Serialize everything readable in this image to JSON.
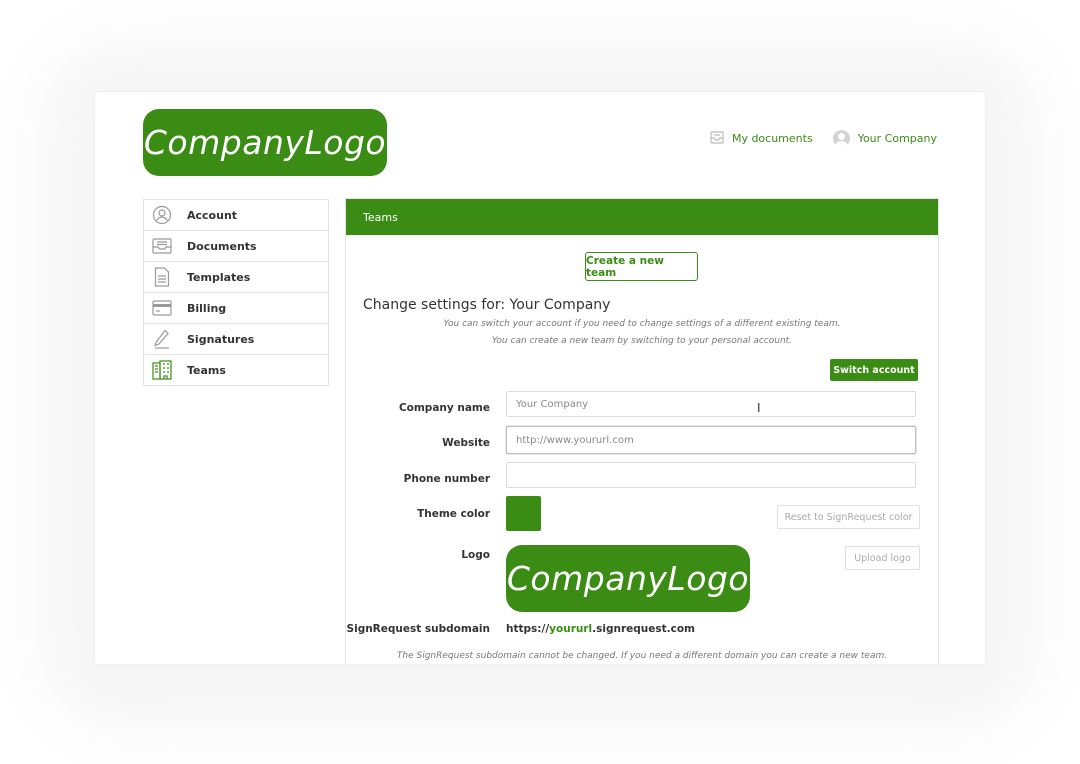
{
  "brand": {
    "logo_text": "CompanyLogo",
    "accent": "#3a8c14"
  },
  "topnav": {
    "my_documents": "My documents",
    "account_name": "Your Company"
  },
  "sidebar": {
    "items": [
      {
        "label": "Account",
        "icon": "user-circle-icon"
      },
      {
        "label": "Documents",
        "icon": "inbox-tray-icon"
      },
      {
        "label": "Templates",
        "icon": "document-icon"
      },
      {
        "label": "Billing",
        "icon": "credit-card-icon"
      },
      {
        "label": "Signatures",
        "icon": "pen-icon"
      },
      {
        "label": "Teams",
        "icon": "building-icon"
      }
    ]
  },
  "panel": {
    "title": "Teams",
    "create_team_label": "Create a new team",
    "settings_title": "Change settings for: Your Company",
    "hint_switch": "You can switch your account if you need to change settings of a different existing team.",
    "hint_create": "You can create a new team by switching to your personal account.",
    "switch_account_label": "Switch account"
  },
  "form": {
    "company_name_label": "Company name",
    "company_name_placeholder": "Your Company",
    "website_label": "Website",
    "website_placeholder": "http://www.yoururl.com",
    "phone_label": "Phone number",
    "phone_value": "",
    "theme_color_label": "Theme color",
    "theme_color_value": "#3a8c14",
    "reset_color_label": "Reset to SignRequest color",
    "logo_label": "Logo",
    "upload_logo_label": "Upload logo",
    "subdomain_label": "SignRequest subdomain",
    "subdomain_prefix": "https://",
    "subdomain_name": "yoururl",
    "subdomain_suffix": ".signrequest.com",
    "subdomain_hint": "The SignRequest subdomain cannot be changed. If you need a different domain you can create a new team."
  }
}
